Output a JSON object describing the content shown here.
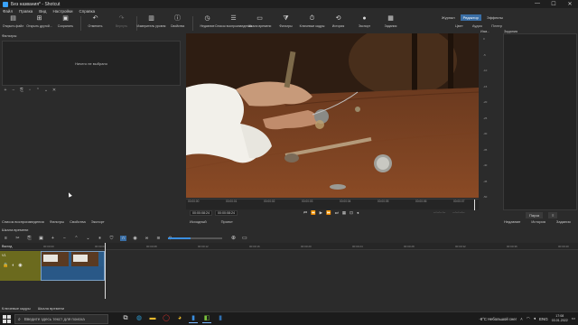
{
  "window": {
    "title": "Без названия* - Shotcut"
  },
  "menu": [
    "Файл",
    "Правка",
    "Вид",
    "Настройки",
    "Справка"
  ],
  "toolbar": [
    {
      "label": "Открыть файл",
      "icon": "folder-open-icon",
      "glyph": "▤",
      "enabled": true
    },
    {
      "label": "Открыть другой...",
      "icon": "open-other-icon",
      "glyph": "⊞",
      "enabled": true
    },
    {
      "label": "Сохранить",
      "icon": "save-icon",
      "glyph": "▣",
      "enabled": true
    },
    {
      "label": "Отменить",
      "icon": "undo-icon",
      "glyph": "↶",
      "enabled": true
    },
    {
      "label": "Вернуть",
      "icon": "redo-icon",
      "glyph": "↷",
      "enabled": false
    },
    {
      "label": "Измеритель уровня",
      "icon": "level-meter-icon",
      "glyph": "▥",
      "enabled": true
    },
    {
      "label": "Свойства",
      "icon": "properties-icon",
      "glyph": "ⓘ",
      "enabled": true
    },
    {
      "label": "Недавние",
      "icon": "recent-icon",
      "glyph": "◷",
      "enabled": true
    },
    {
      "label": "Список воспроизведения",
      "icon": "playlist-icon",
      "glyph": "☰",
      "enabled": true
    },
    {
      "label": "Шкала времени",
      "icon": "timeline-icon",
      "glyph": "▭",
      "enabled": true
    },
    {
      "label": "Фильтры",
      "icon": "filters-icon",
      "glyph": "⧩",
      "enabled": true
    },
    {
      "label": "Ключевые кадры",
      "icon": "keyframes-icon",
      "glyph": "⏱",
      "enabled": true
    },
    {
      "label": "История",
      "icon": "history-icon",
      "glyph": "⟲",
      "enabled": true
    },
    {
      "label": "Экспорт",
      "icon": "export-icon",
      "glyph": "●",
      "enabled": true
    },
    {
      "label": "Задания",
      "icon": "jobs-icon",
      "glyph": "▦",
      "enabled": true
    }
  ],
  "layouts": {
    "items": [
      "Журнал",
      "Редактор",
      "Эффекты"
    ],
    "active": "Редактор",
    "sub": [
      "Цвет",
      "Аудио",
      "Плеер"
    ]
  },
  "filters": {
    "title": "Фильтры",
    "empty_text": "Ничего не выбрано",
    "tools": [
      {
        "icon": "add-icon",
        "glyph": "+"
      },
      {
        "icon": "remove-icon",
        "glyph": "−"
      },
      {
        "icon": "copy-icon",
        "glyph": "⎘"
      },
      {
        "icon": "paste-icon",
        "glyph": "▫"
      },
      {
        "icon": "move-up-icon",
        "glyph": "⌃"
      },
      {
        "icon": "move-down-icon",
        "glyph": "⌄"
      },
      {
        "icon": "close-icon",
        "glyph": "✕"
      }
    ]
  },
  "left_tabs": [
    "Список воспроизведения",
    "Фильтры",
    "Свойства",
    "Экспорт"
  ],
  "ruler": {
    "ticks": [
      "00:00:00",
      "00:00:01",
      "00:00:02",
      "00:00:03",
      "00:00:04",
      "00:00:05",
      "00:00:06",
      "00:00:07"
    ]
  },
  "player": {
    "current_time": "00:00:08:24",
    "total_time": "00:00:08:24",
    "controls": [
      {
        "icon": "skip-start-icon",
        "glyph": "⏮"
      },
      {
        "icon": "rewind-icon",
        "glyph": "⏪"
      },
      {
        "icon": "play-icon",
        "glyph": "▶"
      },
      {
        "icon": "fast-forward-icon",
        "glyph": "⏩"
      },
      {
        "icon": "skip-end-icon",
        "glyph": "⏭"
      },
      {
        "icon": "grid-icon",
        "glyph": "▦"
      },
      {
        "icon": "zoom-icon",
        "glyph": "⊡"
      },
      {
        "icon": "volume-icon",
        "glyph": "◂"
      }
    ],
    "in_point": "--:--:--:--",
    "out_point": "--:--:--:--",
    "tabs": [
      "Исходный",
      "Проект"
    ]
  },
  "meter": {
    "title": "Изм...",
    "db_labels": [
      "0",
      "-5",
      "-10",
      "-15",
      "-20",
      "-25",
      "-30",
      "-35",
      "-40",
      "-45",
      "-50"
    ]
  },
  "history": {
    "title": "Задания",
    "pause_button": "Пауза",
    "menu_glyph": "≡",
    "tabs": [
      "Недавние",
      "История",
      "Задания"
    ]
  },
  "timeline": {
    "title": "Шкала времени",
    "tools": [
      {
        "icon": "menu-icon",
        "glyph": "≡"
      },
      {
        "icon": "cut-icon",
        "glyph": "✂"
      },
      {
        "icon": "copy-icon",
        "glyph": "⎘"
      },
      {
        "icon": "paste-icon",
        "glyph": "▣"
      },
      {
        "icon": "append-icon",
        "glyph": "+"
      },
      {
        "icon": "ripple-delete-icon",
        "glyph": "−"
      },
      {
        "icon": "lift-icon",
        "glyph": "⌃"
      },
      {
        "icon": "overwrite-icon",
        "glyph": "⌄"
      },
      {
        "icon": "split-icon",
        "glyph": "⏸"
      },
      {
        "icon": "marker-icon",
        "glyph": "⛉"
      },
      {
        "icon": "snap-icon",
        "glyph": "∩"
      },
      {
        "icon": "scrub-icon",
        "glyph": "◉"
      },
      {
        "icon": "ripple-icon",
        "glyph": "∞"
      },
      {
        "icon": "ripple-all-icon",
        "glyph": "≋"
      },
      {
        "icon": "zoom-out-icon",
        "glyph": "⊖"
      }
    ],
    "zoom_fill_fraction": 0.42,
    "zoom_in_glyph": "⊕",
    "zoom_fit_glyph": "▭",
    "header_name": "Выход",
    "header_ticks": [
      "00:00:00",
      "00:00:04",
      "00:00:08",
      "00:00:12",
      "00:00:16",
      "00:00:20",
      "00:00:24",
      "00:00:28",
      "00:00:32",
      "00:00:36",
      "00:00:40"
    ],
    "track_name": "V1",
    "track_icons": [
      {
        "icon": "lock-icon",
        "glyph": "🔒"
      },
      {
        "icon": "mute-icon",
        "glyph": "◐"
      },
      {
        "icon": "eye-icon",
        "glyph": "◉"
      }
    ],
    "tabs": [
      "Ключевые кадры",
      "Шкала времени"
    ]
  },
  "taskbar": {
    "search_placeholder": "Введите здесь текст для поиска",
    "apps": [
      {
        "icon": "task-view-icon",
        "glyph": "⧉",
        "color": "#dddddd",
        "running": false
      },
      {
        "icon": "edge-icon",
        "glyph": "◍",
        "color": "#2fa0d8",
        "running": false
      },
      {
        "icon": "file-explorer-icon",
        "glyph": "▬",
        "color": "#e8b92c",
        "running": false
      },
      {
        "icon": "opera-icon",
        "glyph": "◯",
        "color": "#e0302d",
        "running": false
      },
      {
        "icon": "chrome-icon",
        "glyph": "◕",
        "color": "#e3b52a",
        "running": false
      },
      {
        "icon": "app-icon",
        "glyph": "▮",
        "color": "#3a8ee0",
        "running": true
      },
      {
        "icon": "shotcut-icon",
        "glyph": "◧",
        "color": "#7bc33d",
        "running": true
      },
      {
        "icon": "app2-icon",
        "glyph": "▮",
        "color": "#2f6fb0",
        "running": false
      }
    ],
    "weather": "-8°C Небольшой снег",
    "lang": "ENG",
    "time": "17:08",
    "date": "03.01.2022"
  },
  "colors": {
    "accent": "#3a6ea5",
    "track_header": "#6b6a1e",
    "clip": "#2b5c8a",
    "background": "#2b2b2b"
  }
}
